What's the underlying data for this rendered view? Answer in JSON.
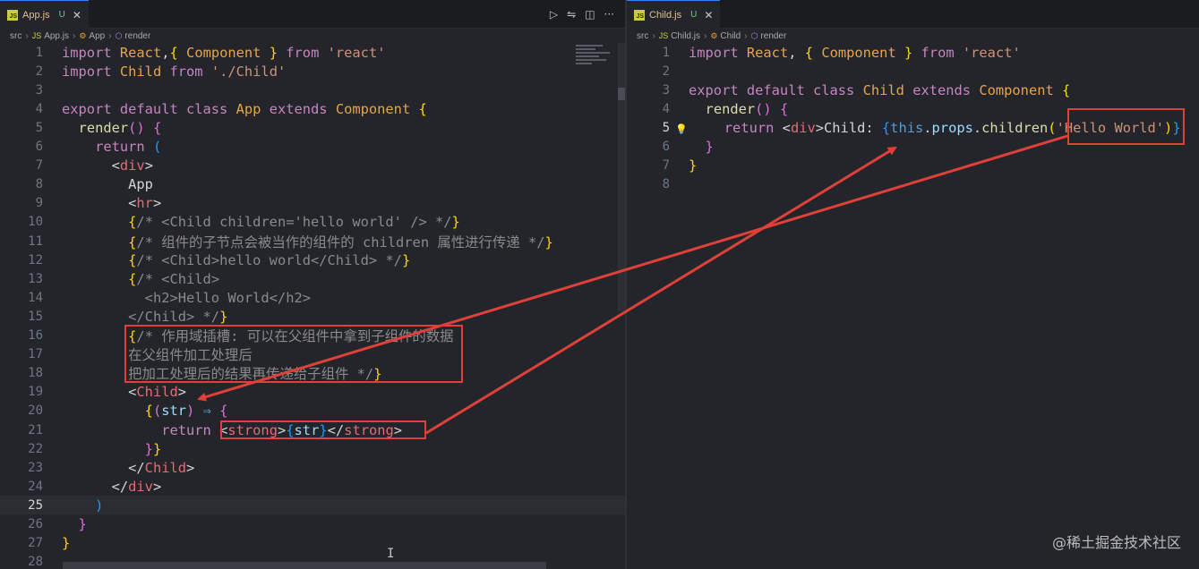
{
  "left": {
    "tab": {
      "name": "App.js",
      "status": "U",
      "icon": "JS"
    },
    "breadcrumb": [
      "src",
      "App.js",
      "App",
      "render"
    ],
    "lines": [
      [
        [
          "kw",
          "import "
        ],
        [
          "cls",
          "React"
        ],
        [
          "",
          ","
        ],
        [
          "br1",
          "{ "
        ],
        [
          "cls",
          "Component"
        ],
        [
          "br1",
          " }"
        ],
        [
          "kw",
          " from "
        ],
        [
          "str",
          "'react'"
        ]
      ],
      [
        [
          "kw",
          "import "
        ],
        [
          "cls",
          "Child"
        ],
        [
          "kw",
          " from "
        ],
        [
          "str",
          "'./Child'"
        ]
      ],
      [],
      [
        [
          "kw",
          "export default class "
        ],
        [
          "cls",
          "App"
        ],
        [
          "kw",
          " extends "
        ],
        [
          "cls",
          "Component"
        ],
        [
          "br1",
          " {"
        ]
      ],
      [
        [
          "",
          "  "
        ],
        [
          "fn",
          "render"
        ],
        [
          "br2",
          "()"
        ],
        [
          "br2",
          " {"
        ]
      ],
      [
        [
          "",
          "    "
        ],
        [
          "kw",
          "return "
        ],
        [
          "br3",
          "("
        ]
      ],
      [
        [
          "",
          "      "
        ],
        [
          "",
          "<"
        ],
        [
          "tag",
          "div"
        ],
        [
          "",
          ">"
        ]
      ],
      [
        [
          "",
          "        App"
        ]
      ],
      [
        [
          "",
          "        <"
        ],
        [
          "tag",
          "hr"
        ],
        [
          "",
          ">"
        ],
        [
          "",
          ""
        ]
      ],
      [
        [
          "",
          "        "
        ],
        [
          "br1",
          "{"
        ],
        [
          "cmt",
          "/* <Child children='hello world' /> */"
        ],
        [
          "br1",
          "}"
        ]
      ],
      [
        [
          "",
          "        "
        ],
        [
          "br1",
          "{"
        ],
        [
          "cmt",
          "/* 组件的子节点会被当作的组件的 children 属性进行传递 */"
        ],
        [
          "br1",
          "}"
        ]
      ],
      [
        [
          "",
          "        "
        ],
        [
          "br1",
          "{"
        ],
        [
          "cmt",
          "/* <Child>hello world</Child> */"
        ],
        [
          "br1",
          "}"
        ]
      ],
      [
        [
          "",
          "        "
        ],
        [
          "br1",
          "{"
        ],
        [
          "cmt",
          "/* <Child>"
        ]
      ],
      [
        [
          "",
          "          "
        ],
        [
          "cmt",
          "<h2>Hello World</h2>"
        ]
      ],
      [
        [
          "",
          "        "
        ],
        [
          "cmt",
          "</Child> */"
        ],
        [
          "br1",
          "}"
        ]
      ],
      [
        [
          "",
          "        "
        ],
        [
          "br1",
          "{"
        ],
        [
          "cmt",
          "/* 作用域插槽: 可以在父组件中拿到子组件的数据"
        ]
      ],
      [
        [
          "",
          "        "
        ],
        [
          "cmt",
          "在父组件加工处理后"
        ]
      ],
      [
        [
          "",
          "        "
        ],
        [
          "cmt",
          "把加工处理后的结果再传递给子组件 */"
        ],
        [
          "br1",
          "}"
        ]
      ],
      [
        [
          "",
          "        <"
        ],
        [
          "tag",
          "Child"
        ],
        [
          "",
          ">"
        ]
      ],
      [
        [
          "",
          "          "
        ],
        [
          "br1",
          "{"
        ],
        [
          "br2",
          "("
        ],
        [
          "prop",
          "str"
        ],
        [
          "br2",
          ")"
        ],
        [
          "kw2",
          " ⇒ "
        ],
        [
          "br2",
          "{"
        ]
      ],
      [
        [
          "",
          "            "
        ],
        [
          "kw",
          "return "
        ],
        [
          "",
          "<"
        ],
        [
          "tag",
          "strong"
        ],
        [
          "",
          ">"
        ],
        [
          "br3",
          "{"
        ],
        [
          "prop",
          "str"
        ],
        [
          "br3",
          "}"
        ],
        [
          "",
          "</"
        ],
        [
          "tag",
          "strong"
        ],
        [
          "",
          ">"
        ]
      ],
      [
        [
          "",
          "          "
        ],
        [
          "br2",
          "}"
        ],
        [
          "br1",
          "}"
        ]
      ],
      [
        [
          "",
          "        </"
        ],
        [
          "tag",
          "Child"
        ],
        [
          "",
          ">"
        ]
      ],
      [
        [
          "",
          "      </"
        ],
        [
          "tag",
          "div"
        ],
        [
          "",
          ">"
        ]
      ],
      [
        [
          "",
          "    "
        ],
        [
          "br3",
          ")"
        ]
      ],
      [
        [
          "",
          "  "
        ],
        [
          "br2",
          "}"
        ]
      ],
      [
        [
          "br1",
          "}"
        ]
      ],
      []
    ]
  },
  "right": {
    "tab": {
      "name": "Child.js",
      "status": "U",
      "icon": "JS"
    },
    "breadcrumb": [
      "src",
      "Child.js",
      "Child",
      "render"
    ],
    "lines": [
      [
        [
          "kw",
          "import "
        ],
        [
          "cls",
          "React"
        ],
        [
          "",
          ", "
        ],
        [
          "br1",
          "{ "
        ],
        [
          "cls",
          "Component"
        ],
        [
          "br1",
          " }"
        ],
        [
          "kw",
          " from "
        ],
        [
          "str",
          "'react'"
        ]
      ],
      [],
      [
        [
          "kw",
          "export default class "
        ],
        [
          "cls",
          "Child"
        ],
        [
          "kw",
          " extends "
        ],
        [
          "cls",
          "Component"
        ],
        [
          "br1",
          " {"
        ]
      ],
      [
        [
          "",
          "  "
        ],
        [
          "fn",
          "render"
        ],
        [
          "br2",
          "()"
        ],
        [
          "br2",
          " {"
        ]
      ],
      [
        [
          "",
          "    "
        ],
        [
          "kw",
          "return "
        ],
        [
          "",
          "<"
        ],
        [
          "tag",
          "div"
        ],
        [
          "",
          ">Child: "
        ],
        [
          "br3",
          "{"
        ],
        [
          "kw2",
          "this"
        ],
        [
          "",
          "."
        ],
        [
          "prop",
          "props"
        ],
        [
          "",
          "."
        ],
        [
          "fn",
          "children"
        ],
        [
          "br1",
          "("
        ],
        [
          "str",
          "'Hello World'"
        ],
        [
          "br1",
          ")"
        ],
        [
          "br3",
          "}"
        ]
      ],
      [
        [
          "",
          "  "
        ],
        [
          "br2",
          "}"
        ]
      ],
      [
        [
          "br1",
          "}"
        ]
      ],
      []
    ]
  },
  "watermark": "@稀土掘金技术社区",
  "cursor_glyph": "I"
}
